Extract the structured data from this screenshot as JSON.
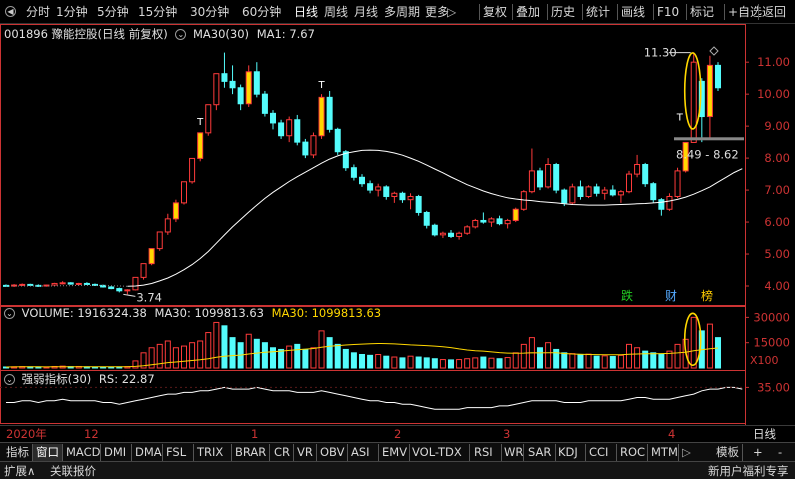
{
  "toolbar": {
    "periods": [
      "分时",
      "1分钟",
      "5分钟",
      "15分钟",
      "30分钟",
      "60分钟",
      "日线",
      "周线",
      "月线",
      "多周期",
      "更多"
    ],
    "active_period": "日线",
    "more_arrow": "▷",
    "tools": [
      "复权",
      "叠加",
      "历史",
      "统计",
      "画线",
      "F10",
      "标记",
      "+自选",
      "返回"
    ]
  },
  "main_info": {
    "stock": "001896 豫能控股(日线 前复权)",
    "ma_label": "MA30(30)",
    "ma_value": "MA1: 7.67"
  },
  "volume_info": {
    "label": "VOLUME: 1916324.38",
    "ma30": "MA30: 1099813.63",
    "ma30_yellow": "MA30: 1099813.63"
  },
  "rs_info": {
    "label": "强弱指标(30)",
    "value": "RS: 22.87"
  },
  "price_axis": [
    "11.00",
    "10.00",
    "9.00",
    "8.00",
    "7.00",
    "6.00",
    "5.00",
    "4.00"
  ],
  "volume_axis": [
    "30000",
    "15000"
  ],
  "volume_unit": "X100",
  "rs_axis": [
    "35.00"
  ],
  "annotations": {
    "high": "11.30",
    "low": "3.74",
    "range": "8.49 - 8.62",
    "badge1": "跌",
    "badge2": "财",
    "badge3": "榜",
    "t_marker": "T"
  },
  "date_axis": [
    "2020年",
    "12",
    "1",
    "2",
    "3",
    "4"
  ],
  "period_right": "日线",
  "tabs": [
    "指标",
    "窗口",
    "MACD",
    "DMI",
    "DMA",
    "FSL",
    "TRIX",
    "BRAR",
    "CR",
    "VR",
    "OBV",
    "ASI",
    "EMV",
    "VOL-TDX",
    "RSI",
    "WR",
    "SAR",
    "KDJ",
    "CCI",
    "ROC",
    "MTM"
  ],
  "tab_more": "▷",
  "tab_right": "模板",
  "tab_plus": "+",
  "tab_minus": "-",
  "status": {
    "expand": "扩展∧",
    "related": "关联报价",
    "promo": "新用户福利专享"
  },
  "colors": {
    "up": "#ff3b3b",
    "down": "#54fcfc",
    "ma": "#ffffff",
    "yellow": "#ffd700",
    "axis": "#cc3333"
  },
  "chart_data": {
    "type": "candlestick",
    "ylim": [
      3.5,
      11.6
    ],
    "volume_ylim": [
      0,
      32000
    ],
    "rs_ylim": [
      15,
      40
    ],
    "candles": [
      [
        4.02,
        4.05,
        3.98,
        4.0,
        600
      ],
      [
        4.0,
        4.06,
        3.97,
        4.03,
        700
      ],
      [
        4.03,
        4.08,
        4.0,
        4.05,
        800
      ],
      [
        4.05,
        4.07,
        4.01,
        4.02,
        700
      ],
      [
        4.02,
        4.05,
        3.98,
        4.01,
        650
      ],
      [
        4.01,
        4.04,
        3.98,
        4.03,
        600
      ],
      [
        4.03,
        4.1,
        4.01,
        4.08,
        900
      ],
      [
        4.08,
        4.15,
        4.05,
        4.1,
        1100
      ],
      [
        4.1,
        4.12,
        4.04,
        4.06,
        800
      ],
      [
        4.06,
        4.1,
        4.02,
        4.08,
        900
      ],
      [
        4.08,
        4.12,
        4.03,
        4.05,
        700
      ],
      [
        4.05,
        4.08,
        4.0,
        4.02,
        600
      ],
      [
        4.02,
        4.04,
        3.95,
        3.97,
        600
      ],
      [
        3.97,
        4.0,
        3.9,
        3.92,
        550
      ],
      [
        3.92,
        3.95,
        3.8,
        3.85,
        650
      ],
      [
        3.85,
        3.9,
        3.74,
        3.88,
        800
      ],
      [
        3.88,
        4.27,
        3.86,
        4.27,
        4200
      ],
      [
        4.27,
        4.7,
        4.2,
        4.7,
        9000
      ],
      [
        4.7,
        5.17,
        4.65,
        5.17,
        12000
      ],
      [
        5.17,
        5.69,
        5.1,
        5.69,
        14000
      ],
      [
        5.69,
        6.26,
        5.6,
        6.1,
        16000
      ],
      [
        6.1,
        6.7,
        6.0,
        6.6,
        12000
      ],
      [
        6.6,
        7.26,
        6.55,
        7.26,
        13000
      ],
      [
        7.26,
        7.99,
        7.2,
        7.99,
        15000
      ],
      [
        7.99,
        8.79,
        7.9,
        8.79,
        16000
      ],
      [
        8.79,
        9.67,
        8.7,
        9.67,
        21000
      ],
      [
        9.67,
        10.64,
        9.5,
        10.64,
        27000
      ],
      [
        10.64,
        11.3,
        10.2,
        10.4,
        25000
      ],
      [
        10.4,
        10.9,
        10.0,
        10.2,
        18000
      ],
      [
        10.2,
        10.3,
        9.5,
        9.7,
        15000
      ],
      [
        9.7,
        10.9,
        9.6,
        10.7,
        20000
      ],
      [
        10.7,
        11.0,
        9.9,
        10.0,
        17000
      ],
      [
        10.0,
        10.1,
        9.3,
        9.4,
        15000
      ],
      [
        9.4,
        9.5,
        8.9,
        9.1,
        12000
      ],
      [
        9.1,
        9.2,
        8.6,
        8.7,
        11000
      ],
      [
        8.7,
        9.3,
        8.5,
        9.2,
        13000
      ],
      [
        9.2,
        9.35,
        8.4,
        8.5,
        14000
      ],
      [
        8.5,
        8.6,
        8.0,
        8.1,
        11000
      ],
      [
        8.1,
        8.8,
        8.0,
        8.7,
        12000
      ],
      [
        8.7,
        10.0,
        8.6,
        9.9,
        22000
      ],
      [
        9.9,
        10.1,
        8.8,
        8.9,
        18000
      ],
      [
        8.9,
        8.95,
        8.1,
        8.2,
        14000
      ],
      [
        8.2,
        8.25,
        7.6,
        7.7,
        11000
      ],
      [
        7.7,
        7.8,
        7.3,
        7.4,
        9000
      ],
      [
        7.4,
        7.5,
        7.1,
        7.2,
        8000
      ],
      [
        7.2,
        7.3,
        6.9,
        7.0,
        7500
      ],
      [
        7.0,
        7.2,
        6.8,
        7.1,
        8000
      ],
      [
        7.1,
        7.15,
        6.7,
        6.8,
        7000
      ],
      [
        6.8,
        6.95,
        6.6,
        6.9,
        6500
      ],
      [
        6.9,
        6.95,
        6.6,
        6.7,
        6000
      ],
      [
        6.7,
        6.9,
        6.4,
        6.8,
        7000
      ],
      [
        6.8,
        6.85,
        6.2,
        6.3,
        6500
      ],
      [
        6.3,
        6.35,
        5.8,
        5.9,
        6000
      ],
      [
        5.9,
        5.95,
        5.55,
        5.6,
        5500
      ],
      [
        5.6,
        5.7,
        5.5,
        5.65,
        5000
      ],
      [
        5.65,
        5.75,
        5.5,
        5.55,
        4800
      ],
      [
        5.55,
        5.7,
        5.45,
        5.65,
        5000
      ],
      [
        5.65,
        5.9,
        5.6,
        5.85,
        5500
      ],
      [
        5.85,
        6.1,
        5.8,
        6.05,
        6000
      ],
      [
        6.05,
        6.3,
        5.95,
        6.0,
        6500
      ],
      [
        6.0,
        6.15,
        5.85,
        6.1,
        5800
      ],
      [
        6.1,
        6.2,
        5.9,
        5.95,
        5500
      ],
      [
        5.95,
        6.1,
        5.8,
        6.05,
        6200
      ],
      [
        6.05,
        6.45,
        6.0,
        6.4,
        9000
      ],
      [
        6.4,
        7.0,
        6.35,
        6.95,
        14000
      ],
      [
        6.95,
        8.3,
        6.9,
        7.6,
        18000
      ],
      [
        7.6,
        7.7,
        7.0,
        7.1,
        12000
      ],
      [
        7.1,
        8.0,
        7.05,
        7.8,
        15000
      ],
      [
        7.8,
        7.85,
        6.9,
        7.0,
        11000
      ],
      [
        7.0,
        7.05,
        6.5,
        6.6,
        9000
      ],
      [
        6.6,
        7.2,
        6.55,
        7.1,
        8500
      ],
      [
        7.1,
        7.3,
        6.7,
        6.8,
        8000
      ],
      [
        6.8,
        7.15,
        6.75,
        7.1,
        8200
      ],
      [
        7.1,
        7.2,
        6.8,
        6.9,
        7000
      ],
      [
        6.9,
        7.1,
        6.7,
        7.0,
        7200
      ],
      [
        7.0,
        7.15,
        6.8,
        6.85,
        6800
      ],
      [
        6.85,
        7.0,
        6.6,
        6.95,
        7500
      ],
      [
        6.95,
        7.6,
        6.9,
        7.5,
        14000
      ],
      [
        7.5,
        8.1,
        7.4,
        7.8,
        12000
      ],
      [
        7.8,
        7.85,
        7.1,
        7.2,
        10000
      ],
      [
        7.2,
        7.25,
        6.6,
        6.7,
        9000
      ],
      [
        6.7,
        6.75,
        6.2,
        6.4,
        8000
      ],
      [
        6.4,
        6.9,
        6.35,
        6.8,
        10000
      ],
      [
        6.8,
        7.7,
        6.75,
        7.6,
        14000
      ],
      [
        7.6,
        8.49,
        7.55,
        8.49,
        17000
      ],
      [
        8.49,
        11.3,
        8.62,
        11.0,
        30000
      ],
      [
        10.4,
        10.5,
        8.5,
        9.3,
        22000
      ],
      [
        9.3,
        11.2,
        8.6,
        10.9,
        26000
      ],
      [
        10.9,
        11.0,
        10.1,
        10.2,
        18000
      ]
    ],
    "ma30": [
      4.0,
      4.0,
      4.0,
      4.0,
      4.0,
      4.0,
      4.0,
      4.01,
      4.01,
      4.02,
      4.02,
      4.02,
      4.02,
      4.01,
      4.0,
      3.99,
      4.0,
      4.03,
      4.08,
      4.16,
      4.25,
      4.37,
      4.51,
      4.67,
      4.86,
      5.08,
      5.34,
      5.6,
      5.85,
      6.08,
      6.31,
      6.53,
      6.74,
      6.93,
      7.1,
      7.27,
      7.42,
      7.56,
      7.7,
      7.84,
      7.97,
      8.07,
      8.15,
      8.2,
      8.24,
      8.25,
      8.24,
      8.21,
      8.16,
      8.09,
      8.0,
      7.9,
      7.78,
      7.66,
      7.54,
      7.41,
      7.29,
      7.17,
      7.07,
      6.97,
      6.89,
      6.82,
      6.76,
      6.72,
      6.69,
      6.67,
      6.64,
      6.62,
      6.6,
      6.57,
      6.55,
      6.54,
      6.53,
      6.53,
      6.53,
      6.54,
      6.55,
      6.56,
      6.57,
      6.58,
      6.6,
      6.62,
      6.66,
      6.71,
      6.78,
      6.87,
      6.98,
      7.1,
      7.25,
      7.4,
      7.55,
      7.67
    ],
    "rs": [
      26,
      26,
      27,
      27,
      26,
      27,
      27,
      28,
      27,
      27,
      27,
      27,
      26,
      26,
      25,
      26,
      27,
      28,
      29,
      30,
      31,
      31,
      32,
      32,
      33,
      33,
      34,
      35,
      34,
      34,
      34,
      35,
      34,
      33,
      33,
      33,
      32,
      32,
      32,
      33,
      32,
      31,
      30,
      29,
      28,
      27,
      27,
      26,
      26,
      25,
      25,
      24,
      23,
      22,
      22,
      22,
      22,
      23,
      23,
      23,
      23,
      24,
      24,
      25,
      26,
      27,
      27,
      27,
      27,
      26,
      26,
      26,
      27,
      27,
      27,
      27,
      27,
      28,
      29,
      29,
      28,
      28,
      28,
      29,
      30,
      31,
      33,
      34,
      34,
      35,
      35,
      34
    ]
  }
}
